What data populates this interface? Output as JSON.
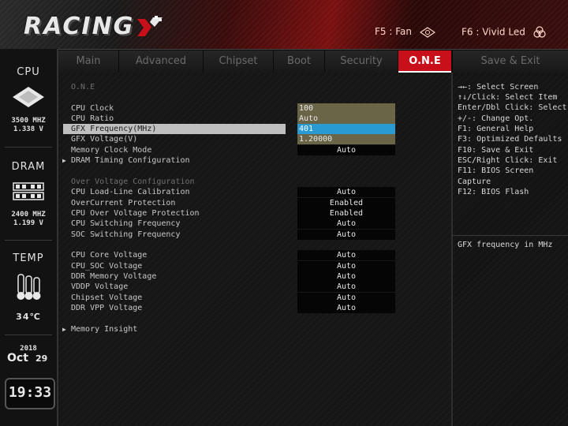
{
  "header": {
    "logo_text": "RACING",
    "hotkey_fan": "F5 : Fan",
    "hotkey_led": "F6 : Vivid Led"
  },
  "sidebar": {
    "cpu": {
      "title": "CPU",
      "freq": "3500 MHZ",
      "volt": "1.338 V"
    },
    "dram": {
      "title": "DRAM",
      "freq": "2400 MHZ",
      "volt": "1.199 V"
    },
    "temp": {
      "title": "TEMP",
      "value": "34℃"
    },
    "date": {
      "year": "2018",
      "month": "Oct",
      "day": "29"
    },
    "time": "19:33"
  },
  "tabs": [
    {
      "label": "Main"
    },
    {
      "label": "Advanced"
    },
    {
      "label": "Chipset"
    },
    {
      "label": "Boot"
    },
    {
      "label": "Security"
    },
    {
      "label": "O.N.E"
    },
    {
      "label": "Save & Exit"
    }
  ],
  "active_tab": "O.N.E",
  "main": {
    "page_heading": "O.N.E",
    "rows_group1": [
      {
        "label": "CPU Clock",
        "value": "100"
      },
      {
        "label": "CPU Ratio",
        "value": "Auto"
      },
      {
        "label": "GFX Frequency(MHz)",
        "value": "401"
      },
      {
        "label": "GFX Voltage(V)",
        "value": "1.20000"
      },
      {
        "label": "Memory Clock Mode",
        "value": "Auto"
      }
    ],
    "dram_timing_label": "DRAM Timing Configuration",
    "over_voltage_heading": "Over Voltage Configuration",
    "rows_group2": [
      {
        "label": "CPU Load-Line Calibration",
        "value": "Auto"
      },
      {
        "label": "OverCurrent Protection",
        "value": "Enabled"
      },
      {
        "label": "CPU Over Voltage Protection",
        "value": "Enabled"
      },
      {
        "label": "CPU Switching Frequency",
        "value": "Auto"
      },
      {
        "label": "SOC Switching Frequency",
        "value": "Auto"
      }
    ],
    "rows_group3": [
      {
        "label": "CPU Core Voltage",
        "value": "Auto"
      },
      {
        "label": "CPU_SOC Voltage",
        "value": "Auto"
      },
      {
        "label": "DDR Memory Voltage",
        "value": "Auto"
      },
      {
        "label": "VDDP Voltage",
        "value": "Auto"
      },
      {
        "label": "Chipset Voltage",
        "value": "Auto"
      },
      {
        "label": "DDR VPP Voltage",
        "value": "Auto"
      }
    ],
    "memory_insight_label": "Memory Insight"
  },
  "help": {
    "keys": [
      "→←: Select Screen",
      "↑↓/Click: Select Item",
      "Enter/Dbl Click: Select",
      "+/-: Change Opt.",
      "F1: General Help",
      "F3: Optimized Defaults",
      "F10: Save & Exit",
      "ESC/Right Click: Exit",
      "F11: BIOS Screen",
      "Capture",
      "F12: BIOS Flash"
    ],
    "description": "GFX frequency in MHz"
  },
  "colors": {
    "accent": "#c8101a",
    "highlight_row": "#bfbfbf",
    "highlight_value": "#2a9ad2",
    "input_field": "#6b6548"
  }
}
